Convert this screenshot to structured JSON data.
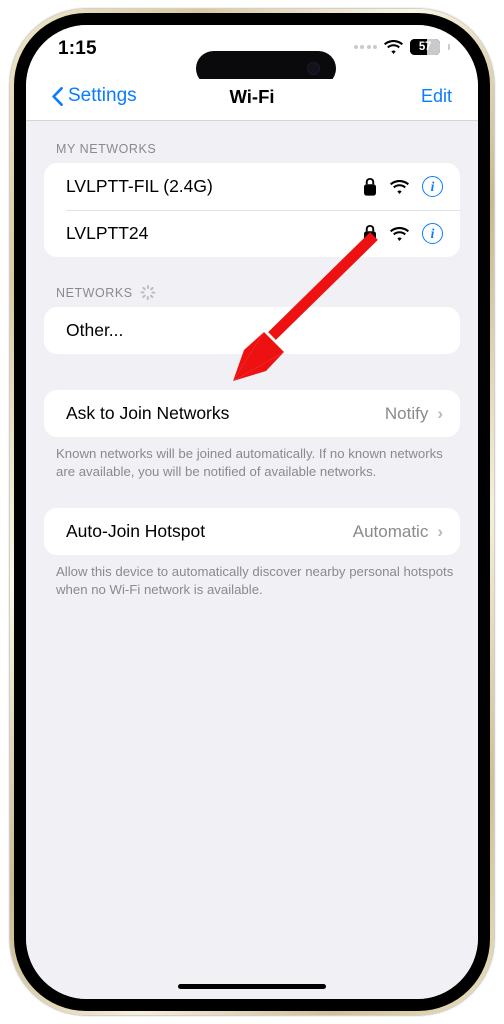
{
  "status_bar": {
    "time": "1:15",
    "signal_icon": "signal-dots-icon",
    "wifi_icon": "wifi-icon",
    "battery_percent": "57",
    "battery_level": 57
  },
  "nav_bar": {
    "back_label": "Settings",
    "back_icon": "chevron-left-icon",
    "title": "Wi-Fi",
    "edit_label": "Edit"
  },
  "sections": {
    "my_networks": {
      "header": "MY NETWORKS",
      "rows": [
        {
          "label": "LVLPTT-FIL (2.4G)",
          "lock_icon": "lock-icon",
          "wifi_icon": "wifi-icon",
          "info_icon": "info-circle-icon"
        },
        {
          "label": "LVLPTT24",
          "lock_icon": "lock-icon",
          "wifi_icon": "wifi-icon",
          "info_icon": "info-circle-icon"
        }
      ]
    },
    "networks": {
      "header": "NETWORKS",
      "spinner_icon": "activity-spinner-icon",
      "rows": [
        {
          "label": "Other..."
        }
      ]
    },
    "ask_to_join": {
      "label": "Ask to Join Networks",
      "value": "Notify",
      "chevron_icon": "chevron-right-icon",
      "footnote": "Known networks will be joined automatically. If no known networks are available, you will be notified of available networks."
    },
    "auto_join_hotspot": {
      "label": "Auto-Join Hotspot",
      "value": "Automatic",
      "chevron_icon": "chevron-right-icon",
      "footnote": "Allow this device to automatically discover nearby personal hotspots when no Wi-Fi network is available."
    }
  },
  "annotation": {
    "type": "arrow",
    "color": "#ee1111",
    "points_to": "Ask to Join Networks"
  },
  "colors": {
    "accent_blue": "#0a7cff",
    "background": "#f1f0f5",
    "card": "#ffffff",
    "secondary_text": "#8a8a8e",
    "annotation_red": "#ee1111"
  }
}
